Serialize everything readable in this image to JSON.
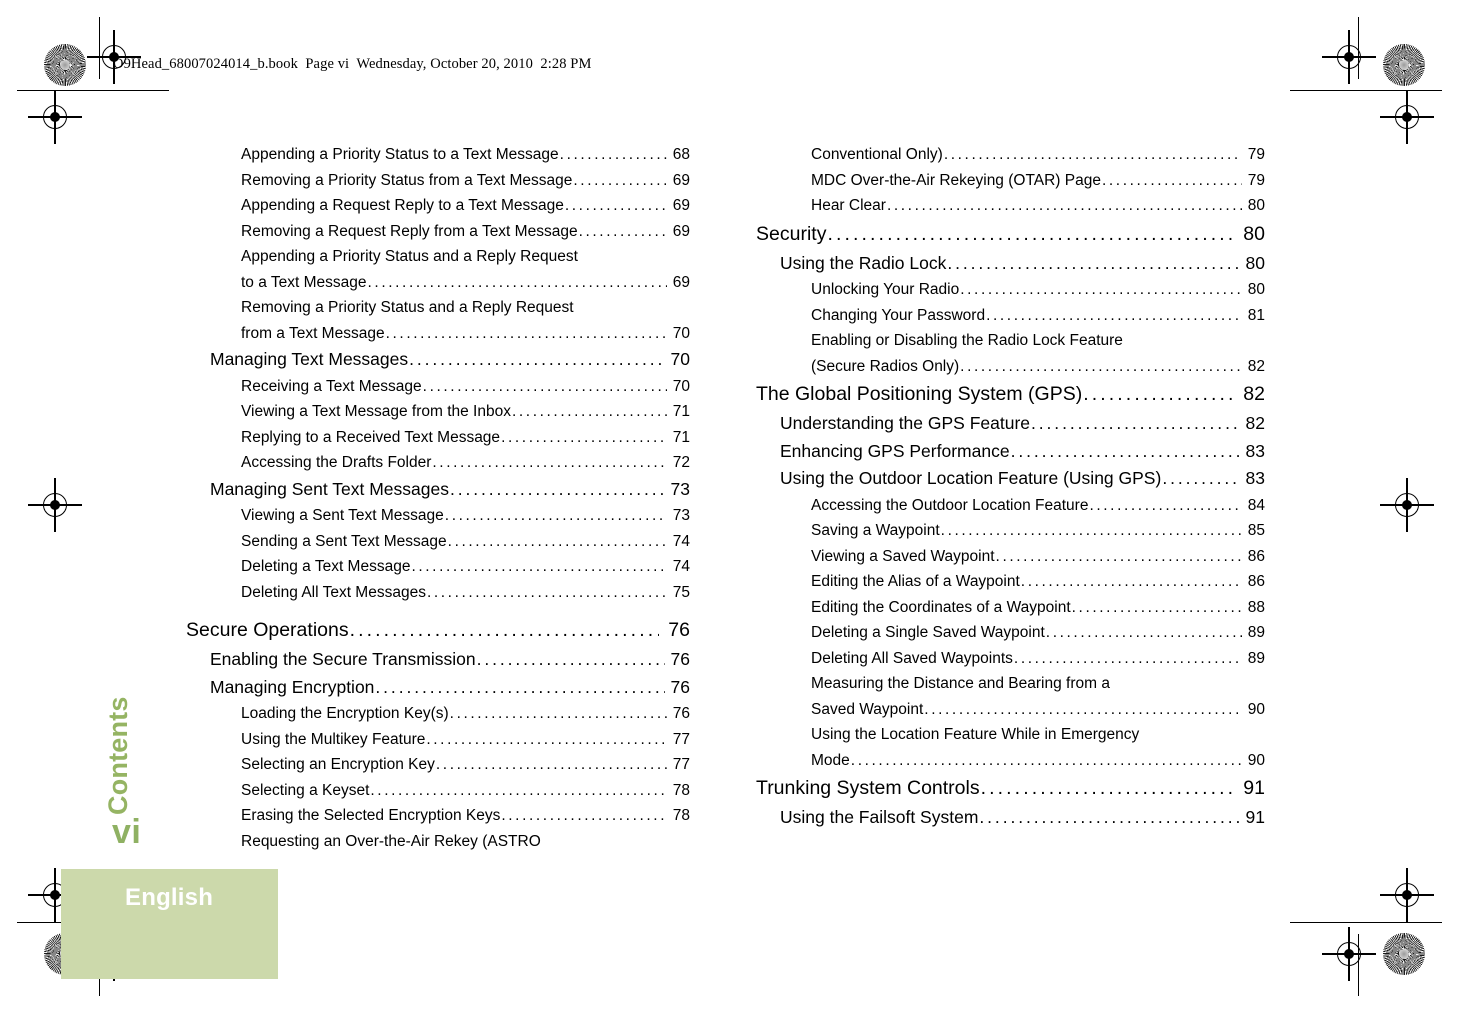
{
  "page": {
    "slug": "O9Head_68007024014_b.book  Page vi  Wednesday, October 20, 2010  2:28 PM",
    "folio": "vi",
    "chapter_label": "Contents",
    "language_tab": "English",
    "colors": {
      "tab_background": "#ccd9ab",
      "tab_text": "#ffffff",
      "chapter_text": "#95b463",
      "folio_text": "#8fb163",
      "body_text": "#000000"
    }
  },
  "toc": {
    "left_column": [
      {
        "level": 3,
        "label": "Appending a Priority Status to a Text Message",
        "page": "68"
      },
      {
        "level": 3,
        "label": "Removing a Priority Status from a Text Message",
        "page": "69"
      },
      {
        "level": 3,
        "label": "Appending a Request Reply to a Text Message",
        "page": "69"
      },
      {
        "level": 3,
        "label": "Removing a Request Reply from a Text Message",
        "page": "69"
      },
      {
        "level": 3,
        "label": "Appending a Priority Status and a Reply Request",
        "page": "",
        "continues": true
      },
      {
        "level": 3,
        "label": "to a Text Message",
        "page": "69"
      },
      {
        "level": 3,
        "label": "Removing a Priority Status and a Reply Request",
        "page": "",
        "continues": true
      },
      {
        "level": 3,
        "label": "from a Text Message",
        "page": "70"
      },
      {
        "level": 2,
        "label": "Managing Text Messages",
        "page": "70"
      },
      {
        "level": 3,
        "label": "Receiving a Text Message",
        "page": "70"
      },
      {
        "level": 3,
        "label": "Viewing a Text Message from the Inbox",
        "page": "71"
      },
      {
        "level": 3,
        "label": "Replying to a Received Text Message",
        "page": "71"
      },
      {
        "level": 3,
        "label": "Accessing the Drafts Folder",
        "page": "72"
      },
      {
        "level": 2,
        "label": "Managing Sent Text Messages",
        "page": "73"
      },
      {
        "level": 3,
        "label": "Viewing a Sent Text Message",
        "page": "73"
      },
      {
        "level": 3,
        "label": "Sending a Sent Text Message",
        "page": "74"
      },
      {
        "level": 3,
        "label": "Deleting a Text Message",
        "page": "74"
      },
      {
        "level": 3,
        "label": "Deleting All Text Messages",
        "page": "75"
      },
      {
        "level": 1,
        "label": "Secure Operations",
        "page": "76",
        "gap_before": true
      },
      {
        "level": 2,
        "label": "Enabling the Secure Transmission",
        "page": "76"
      },
      {
        "level": 2,
        "label": "Managing Encryption",
        "page": "76"
      },
      {
        "level": 3,
        "label": "Loading the Encryption Key(s)",
        "page": "76"
      },
      {
        "level": 3,
        "label": "Using the Multikey Feature",
        "page": "77"
      },
      {
        "level": 3,
        "label": "Selecting an Encryption Key",
        "page": "77"
      },
      {
        "level": 3,
        "label": "Selecting a Keyset",
        "page": "78"
      },
      {
        "level": 3,
        "label": "Erasing the Selected Encryption Keys",
        "page": "78"
      },
      {
        "level": 3,
        "label": "Requesting an Over-the-Air Rekey (ASTRO",
        "page": "",
        "continues": true
      }
    ],
    "right_column": [
      {
        "level": 3,
        "label": "Conventional Only)",
        "page": "79"
      },
      {
        "level": 3,
        "label": "MDC Over-the-Air Rekeying (OTAR) Page",
        "page": "79"
      },
      {
        "level": 3,
        "label": "Hear Clear",
        "page": "80"
      },
      {
        "level": 1,
        "label": "Security",
        "page": "80"
      },
      {
        "level": 2,
        "label": "Using the Radio Lock",
        "page": "80"
      },
      {
        "level": 3,
        "label": "Unlocking Your Radio",
        "page": "80"
      },
      {
        "level": 3,
        "label": "Changing Your Password",
        "page": "81"
      },
      {
        "level": 3,
        "label": "Enabling or Disabling the Radio Lock Feature",
        "page": "",
        "continues": true
      },
      {
        "level": 3,
        "label": "(Secure Radios Only)",
        "page": "82"
      },
      {
        "level": 1,
        "label": "The Global Positioning System (GPS)",
        "page": "82"
      },
      {
        "level": 2,
        "label": "Understanding the GPS Feature",
        "page": "82"
      },
      {
        "level": 2,
        "label": "Enhancing GPS Performance",
        "page": "83"
      },
      {
        "level": 2,
        "label": "Using the Outdoor Location Feature (Using GPS)",
        "page": "83"
      },
      {
        "level": 3,
        "label": "Accessing the Outdoor Location Feature",
        "page": "84"
      },
      {
        "level": 3,
        "label": "Saving a Waypoint",
        "page": "85"
      },
      {
        "level": 3,
        "label": "Viewing a Saved Waypoint",
        "page": "86"
      },
      {
        "level": 3,
        "label": "Editing the Alias of a Waypoint",
        "page": "86"
      },
      {
        "level": 3,
        "label": "Editing the Coordinates of a Waypoint",
        "page": "88"
      },
      {
        "level": 3,
        "label": "Deleting a Single Saved Waypoint",
        "page": "89"
      },
      {
        "level": 3,
        "label": "Deleting All Saved Waypoints",
        "page": "89"
      },
      {
        "level": 3,
        "label": "Measuring the Distance and Bearing from a",
        "page": "",
        "continues": true
      },
      {
        "level": 3,
        "label": "Saved Waypoint",
        "page": "90"
      },
      {
        "level": 3,
        "label": "Using the Location Feature While in Emergency",
        "page": "",
        "continues": true
      },
      {
        "level": 3,
        "label": "Mode",
        "page": "90"
      },
      {
        "level": 1,
        "label": "Trunking System Controls",
        "page": "91"
      },
      {
        "level": 2,
        "label": "Using the Failsoft System",
        "page": "91"
      }
    ]
  }
}
